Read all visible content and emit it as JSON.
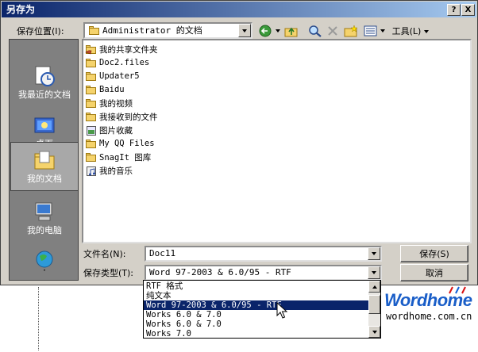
{
  "window": {
    "title": "另存为",
    "help_label": "?",
    "close_label": "X"
  },
  "location": {
    "label": "保存位置(I):",
    "value": "Administrator 的文档"
  },
  "toolbar": {
    "tools_label": "工具(L)"
  },
  "places": [
    {
      "label": "我最近的文档",
      "icon": "recent-documents-icon"
    },
    {
      "label": "桌面",
      "icon": "desktop-icon"
    },
    {
      "label": "我的文档",
      "icon": "my-documents-icon",
      "selected": true
    },
    {
      "label": "我的电脑",
      "icon": "my-computer-icon"
    },
    {
      "label": "",
      "icon": "network-places-icon"
    }
  ],
  "files": [
    {
      "name": "我的共享文件夹",
      "icon": "shared-folder-icon"
    },
    {
      "name": "Doc2.files",
      "icon": "folder-icon"
    },
    {
      "name": "Updater5",
      "icon": "folder-icon"
    },
    {
      "name": "Baidu",
      "icon": "folder-icon"
    },
    {
      "name": "我的视频",
      "icon": "folder-icon"
    },
    {
      "name": "我接收到的文件",
      "icon": "folder-icon"
    },
    {
      "name": "图片收藏",
      "icon": "pictures-folder-icon"
    },
    {
      "name": "My QQ Files",
      "icon": "folder-icon"
    },
    {
      "name": "SnagIt 图库",
      "icon": "folder-icon"
    },
    {
      "name": "我的音乐",
      "icon": "music-folder-icon"
    }
  ],
  "filename": {
    "label": "文件名(N):",
    "value": "Doc11"
  },
  "filetype": {
    "label": "保存类型(T):",
    "value": "Word 97-2003 & 6.0/95 - RTF",
    "options": [
      "RTF 格式",
      "纯文本",
      "Word 97-2003 & 6.0/95 - RTF",
      "Works 6.0 & 7.0",
      "Works 6.0 & 7.0",
      "Works 7.0"
    ],
    "selected_index": 2
  },
  "buttons": {
    "save": "保存(S)",
    "cancel": "取消"
  },
  "watermark": {
    "brand": "Wordhome",
    "url": "wordhome.com.cn"
  }
}
